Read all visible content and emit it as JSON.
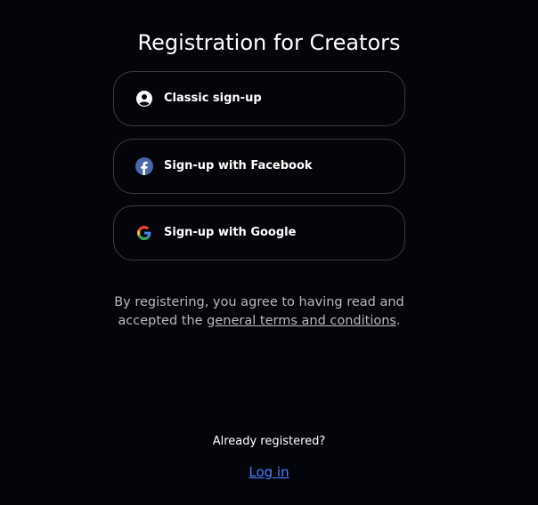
{
  "page": {
    "title": "Registration for Creators"
  },
  "signup_options": {
    "classic": {
      "label": "Classic sign-up",
      "icon": "user-circle-icon"
    },
    "facebook": {
      "label": "Sign-up with Facebook",
      "icon": "facebook-icon"
    },
    "google": {
      "label": "Sign-up with Google",
      "icon": "google-icon"
    }
  },
  "terms": {
    "prefix": "By registering, you agree to having read and accepted the ",
    "link_text": "general terms and conditions",
    "suffix": "."
  },
  "login": {
    "prompt": "Already registered?",
    "link_text": "Log in"
  },
  "colors": {
    "background": "#04050a",
    "button_border": "#3a3b40",
    "link_blue": "#4b7cff",
    "facebook_blue": "#4a67ad"
  }
}
